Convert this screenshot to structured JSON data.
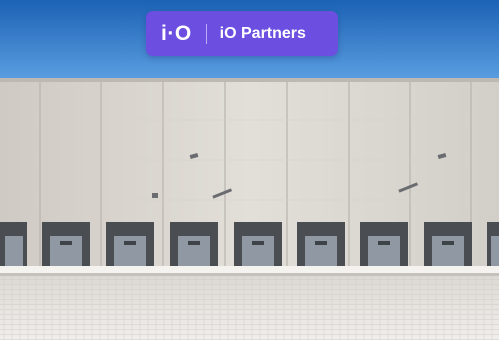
{
  "badge": {
    "logo_text": "i·O",
    "name": "iO Partners",
    "color": "#6c4fe0"
  },
  "scene": {
    "colors": {
      "sky_top": "#1c62b5",
      "sky_bottom": "#5b9ee0",
      "facade": "#d9d6d1",
      "door_frame": "#4a4d52",
      "door": "#8f98a3",
      "pavement": "#e9e7e3"
    }
  }
}
